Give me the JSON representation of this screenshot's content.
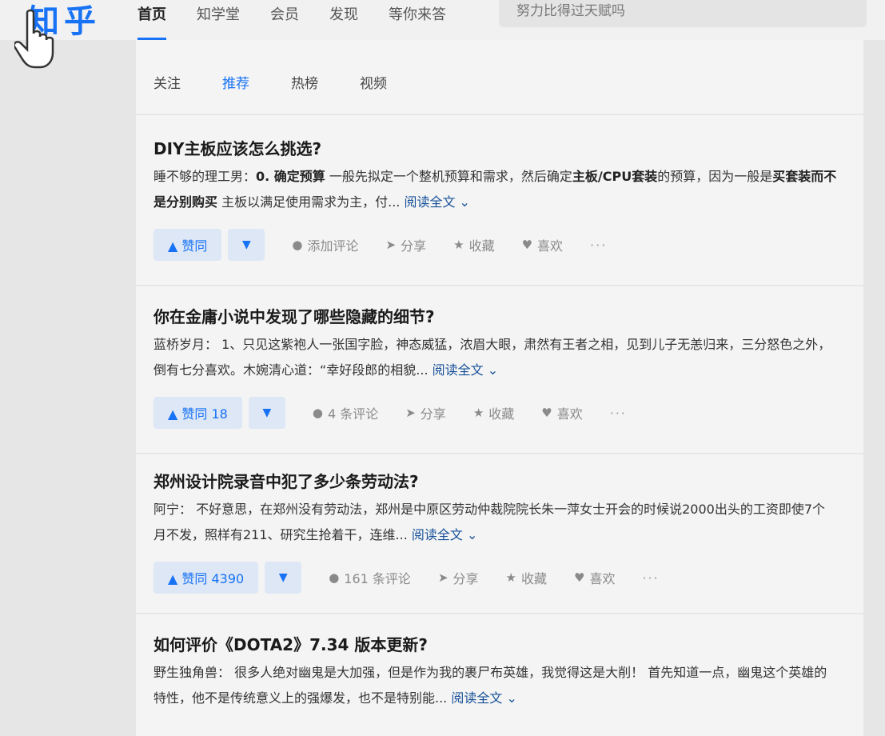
{
  "header": {
    "logo": "知乎",
    "nav": [
      "首页",
      "知学堂",
      "会员",
      "发现",
      "等你来答"
    ],
    "search_value": "努力比得过天赋吗"
  },
  "tabs": [
    "关注",
    "推荐",
    "热榜",
    "视频"
  ],
  "feed": [
    {
      "title": "DIY主板应该怎么挑选?",
      "author": "睡不够的理工男：",
      "excerpt_parts": [
        "0. 确定预算",
        " 一般先拟定一个整机预算和需求，然后确定",
        "主板/CPU套装",
        "的预算，因为一般是",
        "买套装而不是分别购买",
        " 主板以满足使用需求为主，付..."
      ],
      "read_more": "阅读全文 ⌄",
      "vote": "▲ 赞同",
      "comments": "添加评论",
      "share": "分享",
      "favorite": "收藏",
      "like": "喜欢"
    },
    {
      "title": "你在金庸小说中发现了哪些隐藏的细节?",
      "author": "蓝桥岁月：",
      "excerpt_parts": [
        " 1、只见这紫袍人一张国字脸，神态威猛，浓眉大眼，肃然有王者之相，见到儿子无恙归来，三分怒色之外，倒有七分喜欢。木婉清心道：“幸好段郎的相貌..."
      ],
      "read_more": "阅读全文 ⌄",
      "vote": "▲ 赞同 18",
      "comments": "4 条评论",
      "share": "分享",
      "favorite": "收藏",
      "like": "喜欢"
    },
    {
      "title": "郑州设计院录音中犯了多少条劳动法?",
      "author": "阿宁：",
      "excerpt_parts": [
        " 不好意思，在郑州没有劳动法，郑州是中原区劳动仲裁院院长朱一萍女士开会的时候说2000出头的工资即使7个月不发，照样有211、研究生抢着干，连维..."
      ],
      "read_more": "阅读全文 ⌄",
      "vote": "▲ 赞同 4390",
      "comments": "161 条评论",
      "share": "分享",
      "favorite": "收藏",
      "like": "喜欢"
    },
    {
      "title": "如何评价《DOTA2》7.34 版本更新?",
      "author": "野生独角兽：",
      "excerpt_parts": [
        " 很多人绝对幽鬼是大加强，但是作为我的裹尸布英雄，我觉得这是大削！ 首先知道一点，幽鬼这个英雄的特性，他不是传统意义上的强爆发，也不是特别能..."
      ],
      "read_more": "阅读全文 ⌄"
    }
  ],
  "vote_down": "▼",
  "more": "···"
}
